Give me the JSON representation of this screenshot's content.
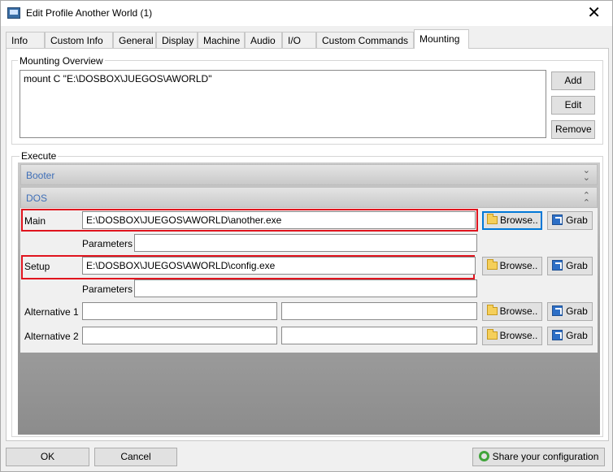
{
  "window": {
    "title": "Edit Profile Another World (1)",
    "close_glyph": "✕"
  },
  "tabs": [
    {
      "label": "Info"
    },
    {
      "label": "Custom Info"
    },
    {
      "label": "General"
    },
    {
      "label": "Display"
    },
    {
      "label": "Machine"
    },
    {
      "label": "Audio"
    },
    {
      "label": "I/O"
    },
    {
      "label": "Custom Commands"
    },
    {
      "label": "Mounting",
      "active": true
    }
  ],
  "mounting": {
    "legend": "Mounting Overview",
    "entries": [
      "mount C \"E:\\DOSBOX\\JUEGOS\\AWORLD\""
    ],
    "add_label": "Add",
    "edit_label": "Edit",
    "remove_label": "Remove"
  },
  "execute": {
    "legend": "Execute",
    "booter_label": "Booter",
    "dos_label": "DOS",
    "main_label": "Main",
    "main_value": "E:\\DOSBOX\\JUEGOS\\AWORLD\\another.exe",
    "parameters_label": "Parameters",
    "main_params_value": "",
    "setup_label": "Setup",
    "setup_value": "E:\\DOSBOX\\JUEGOS\\AWORLD\\config.exe",
    "setup_params_value": "",
    "alt1_label": "Alternative 1",
    "alt2_label": "Alternative 2",
    "browse_label": "Browse..",
    "grab_label": "Grab"
  },
  "footer": {
    "ok_label": "OK",
    "cancel_label": "Cancel",
    "share_label": "Share your configuration"
  },
  "icons": {
    "booter_chevron": "double-chevron-down-icon",
    "dos_chevron": "double-chevron-up-icon"
  },
  "colors": {
    "highlight": "#e0141e",
    "section_label": "#3f6fb8",
    "focus_border": "#0078d7"
  }
}
